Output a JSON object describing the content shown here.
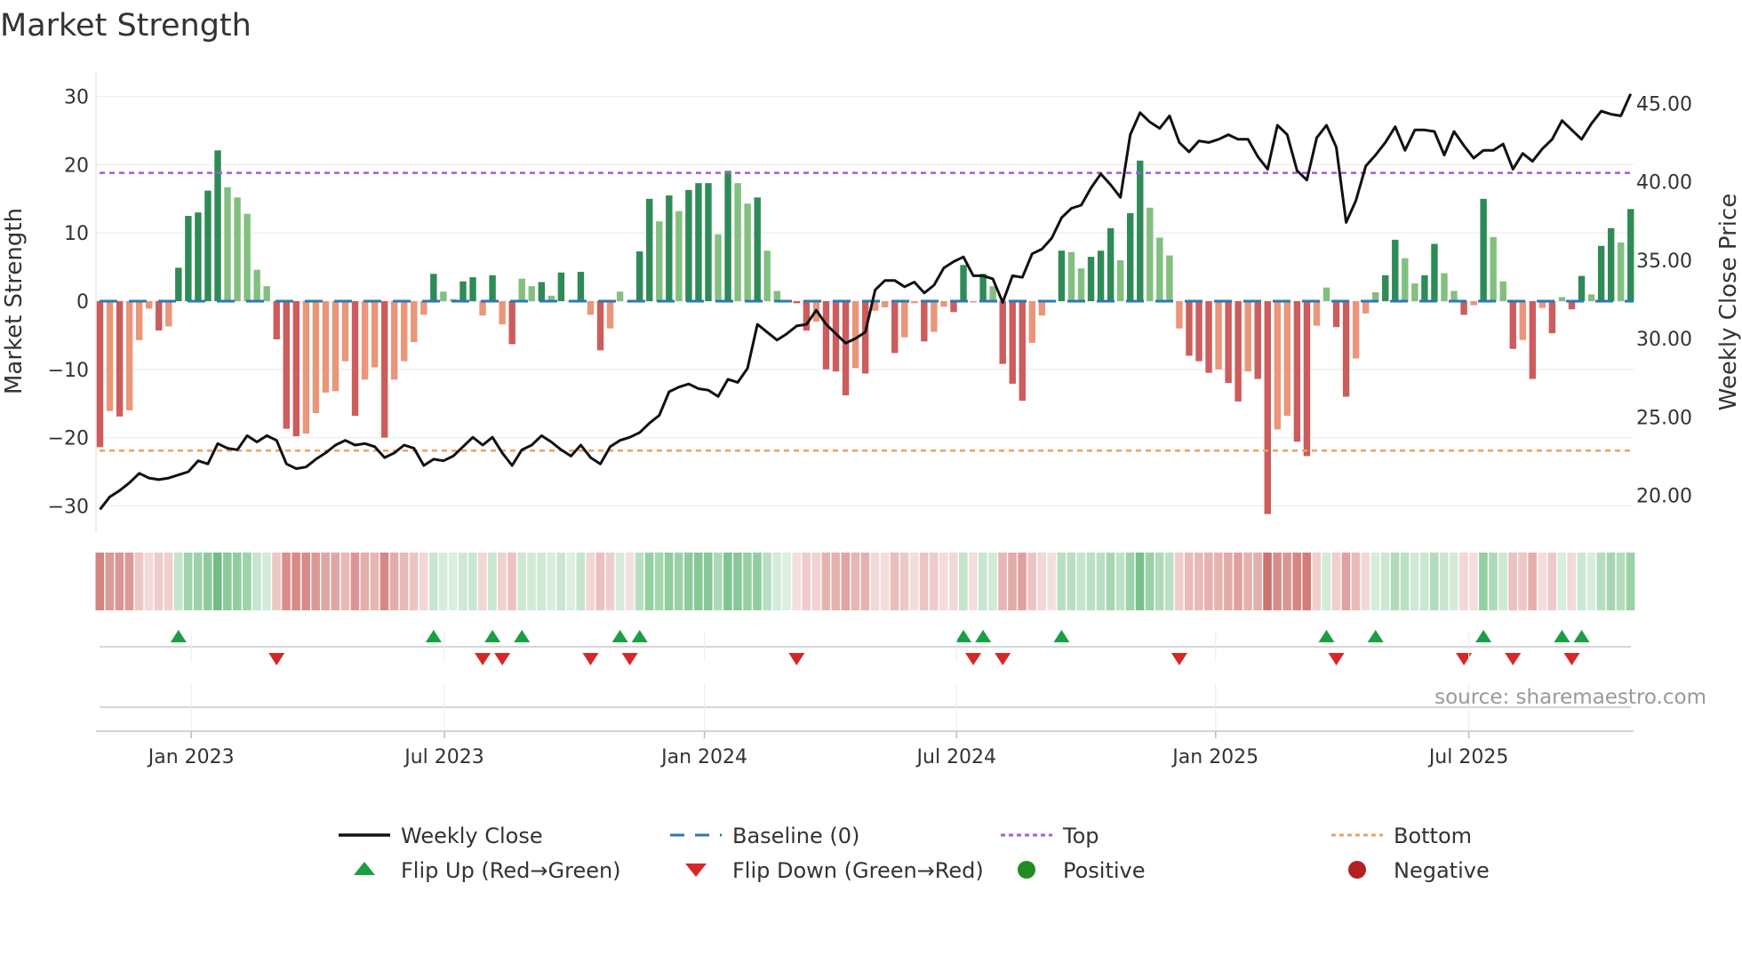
{
  "chart_data": {
    "type": "bar",
    "title": "Market Strength",
    "ylabel": "Market Strength",
    "y2label": "Weekly Close Price",
    "ylim": [
      -33,
      33
    ],
    "y2lim": [
      18.5,
      46.5
    ],
    "y_ticks": [
      -30,
      -20,
      -10,
      0,
      10,
      20,
      30
    ],
    "y_tick_labels": [
      "−30",
      "−20",
      "−10",
      "0",
      "10",
      "20",
      "30"
    ],
    "y2_ticks": [
      20,
      25,
      30,
      35,
      40,
      45
    ],
    "y2_tick_labels": [
      "20.00",
      "25.00",
      "30.00",
      "35.00",
      "40.00",
      "45.00"
    ],
    "x_unit": "weeks",
    "x_ticks": [
      {
        "label": "Jan 2023",
        "week": 9.3
      },
      {
        "label": "Jul 2023",
        "week": 35.1
      },
      {
        "label": "Jan 2024",
        "week": 61.6
      },
      {
        "label": "Jul 2024",
        "week": 87.3
      },
      {
        "label": "Jan 2025",
        "week": 113.7
      },
      {
        "label": "Jul 2025",
        "week": 139.5
      }
    ],
    "grid": true,
    "top_level": 18.8,
    "bottom_level": -21.9,
    "baseline": 0,
    "strength": [
      -21.4,
      -16.1,
      -16.9,
      -16,
      -5.7,
      -1.1,
      -4.3,
      -3.7,
      4.9,
      12.5,
      13,
      16.2,
      22.1,
      16.7,
      15.2,
      12.8,
      4.6,
      2.2,
      -5.6,
      -18.7,
      -19.8,
      -19.4,
      -16.4,
      -13.4,
      -13.2,
      -8.8,
      -16.8,
      -11.5,
      -9.7,
      -20,
      -11.5,
      -8.8,
      -6,
      -2,
      4,
      1.4,
      0.3,
      2.9,
      3.5,
      -2.1,
      3.8,
      -3.4,
      -6.3,
      3.3,
      2.2,
      2.8,
      0.8,
      4.2,
      0,
      4.3,
      -2,
      -7.2,
      -4,
      1.4,
      -0.2,
      7.3,
      15,
      11.7,
      15.5,
      13.2,
      16.3,
      17.3,
      17.3,
      9.8,
      19.1,
      17.3,
      14.3,
      15.2,
      7.4,
      1.5,
      0.2,
      -0.3,
      -4.3,
      -3,
      -10,
      -10.3,
      -13.8,
      -9.8,
      -10.6,
      -1.4,
      -0.9,
      -7.6,
      -5.3,
      -0.3,
      -5.9,
      -4.5,
      -0.8,
      -1.6,
      5.3,
      -0.2,
      4,
      2.2,
      -9.2,
      -12.1,
      -14.6,
      -6.1,
      -2.1,
      -0.2,
      7.4,
      7.2,
      4.8,
      6.5,
      7.4,
      10.7,
      6,
      12.9,
      20.6,
      13.7,
      9.3,
      6.7,
      -4,
      -8,
      -8.8,
      -10.5,
      -10,
      -12,
      -14.7,
      -10.3,
      -11.4,
      -31.2,
      -18.8,
      -16.8,
      -20.6,
      -22.7,
      -3.6,
      2,
      -3.8,
      -14,
      -8.4,
      -1.8,
      1.3,
      3.8,
      9,
      6.3,
      2.6,
      3.8,
      8.4,
      4.1,
      1.5,
      -2,
      -0.6,
      15,
      9.4,
      2.9,
      -7,
      -5.7,
      -11.4,
      -1,
      -4.7,
      0.6,
      -1.2,
      3.7,
      1,
      8.1,
      10.7,
      8.6,
      13.5
    ],
    "weekly_close": [
      19.1,
      19.9,
      20.3,
      20.8,
      21.4,
      21.1,
      21.0,
      21.1,
      21.3,
      21.5,
      22.2,
      22.0,
      23.3,
      23.0,
      22.9,
      23.8,
      23.4,
      23.8,
      23.5,
      22.0,
      21.7,
      21.8,
      22.3,
      22.7,
      23.2,
      23.5,
      23.2,
      23.3,
      23.1,
      22.4,
      22.7,
      23.2,
      23.0,
      21.9,
      22.3,
      22.2,
      22.5,
      23.1,
      23.7,
      23.2,
      23.7,
      22.7,
      21.9,
      22.9,
      23.2,
      23.8,
      23.4,
      22.9,
      22.5,
      23.2,
      22.4,
      22.0,
      23.1,
      23.5,
      23.7,
      24.0,
      24.6,
      25.1,
      26.6,
      26.9,
      27.1,
      26.8,
      26.7,
      26.3,
      27.4,
      27.2,
      28.1,
      30.9,
      30.4,
      29.9,
      30.3,
      30.8,
      30.9,
      31.8,
      30.9,
      30.3,
      29.7,
      30.0,
      30.4,
      33.1,
      33.7,
      33.7,
      33.3,
      33.6,
      32.9,
      33.4,
      34.5,
      34.9,
      35.2,
      34.0,
      34.0,
      33.8,
      32.3,
      34.0,
      33.9,
      35.4,
      35.7,
      36.4,
      37.7,
      38.3,
      38.5,
      39.6,
      40.5,
      39.8,
      39.0,
      43.0,
      44.4,
      43.8,
      43.4,
      44.2,
      42.5,
      41.9,
      42.6,
      42.5,
      42.7,
      43.0,
      42.7,
      42.7,
      41.6,
      40.8,
      43.6,
      43.0,
      40.7,
      40.1,
      42.8,
      43.6,
      42.2,
      37.4,
      38.8,
      41.0,
      41.7,
      42.5,
      43.5,
      42.0,
      43.3,
      43.3,
      43.2,
      41.7,
      43.2,
      42.3,
      41.5,
      42.0,
      42.0,
      42.4,
      40.8,
      41.8,
      41.3,
      42.1,
      42.7,
      43.9,
      43.3,
      42.7,
      43.7,
      44.5,
      44.3,
      44.2,
      45.6
    ],
    "flip_up_weeks": [
      8,
      34,
      40,
      43,
      53,
      55,
      88,
      90,
      98,
      125,
      130,
      141,
      149,
      151
    ],
    "flip_down_weeks": [
      18,
      39,
      41,
      50,
      54,
      71,
      89,
      92,
      110,
      126,
      139,
      144,
      150
    ],
    "legend": {
      "placement": "bottom",
      "entries": [
        "Weekly Close",
        "Baseline (0)",
        "Top",
        "Bottom",
        "Flip Up (Red→Green)",
        "Flip Down (Green→Red)",
        "Positive",
        "Negative"
      ]
    },
    "source": "source: sharemaestro.com"
  },
  "colors": {
    "strong_positive": "#2e8b57",
    "weak_positive": "#82c07f",
    "strong_negative": "#cd5c5c",
    "weak_negative": "#e9967a",
    "baseline": "#2a7ab0",
    "top": "#9b5de5",
    "bottom": "#f0a060",
    "close": "#111111",
    "flip_up": "#1a9e46",
    "flip_down": "#d62728",
    "positive": "#228b22",
    "negative": "#b22222"
  }
}
